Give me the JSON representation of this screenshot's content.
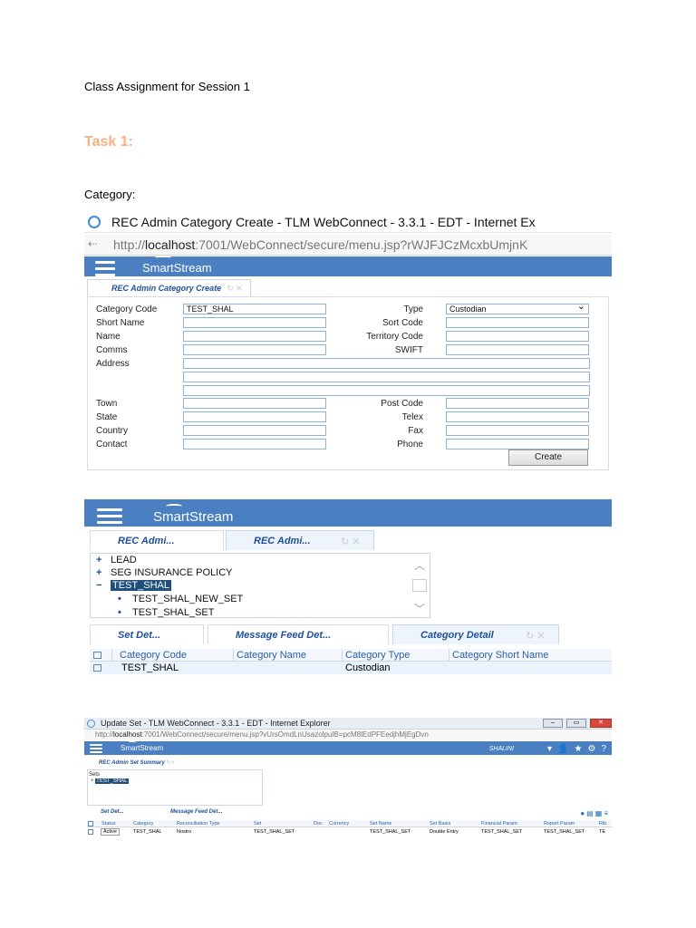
{
  "document": {
    "title": "Class Assignment for Session 1",
    "task_heading": "Task 1:",
    "section_label": "Category:"
  },
  "shot1": {
    "window_title": "REC Admin Category Create - TLM WebConnect - 3.3.1 - EDT - Internet Ex",
    "url_prefix": "http://",
    "url_host": "localhost",
    "url_rest": ":7001/WebConnect/secure/menu.jsp?rWJFJCzMcxbUmjnK",
    "logo": "SmartStream",
    "tab_label": "REC Admin Category Create",
    "tab_icons": "↻ ✕",
    "fields": {
      "category_code_label": "Category Code",
      "category_code_value": "TEST_SHAL",
      "short_name_label": "Short Name",
      "name_label": "Name",
      "comms_label": "Comms",
      "address_label": "Address",
      "town_label": "Town",
      "state_label": "State",
      "country_label": "Country",
      "contact_label": "Contact",
      "type_label": "Type",
      "type_value": "Custodian",
      "sort_code_label": "Sort Code",
      "territory_code_label": "Territory Code",
      "swift_label": "SWIFT",
      "post_code_label": "Post Code",
      "telex_label": "Telex",
      "fax_label": "Fax",
      "phone_label": "Phone"
    },
    "create_button": "Create"
  },
  "shot2": {
    "logo": "SmartStream",
    "top_tabs": [
      "REC Admi...",
      "REC Admi..."
    ],
    "tree": [
      {
        "symbol": "+",
        "label": "LEAD"
      },
      {
        "symbol": "+",
        "label": "SEG INSURANCE POLICY"
      },
      {
        "symbol": "−",
        "label": "TEST_SHAL"
      },
      {
        "symbol": "•",
        "label": "TEST_SHAL_NEW_SET"
      },
      {
        "symbol": "•",
        "label": "TEST_SHAL_SET"
      }
    ],
    "bottom_tabs": [
      "Set Det...",
      "Message Feed Det...",
      "Category Detail"
    ],
    "grid_headers": [
      "Category Code",
      "Category Name",
      "Category Type",
      "Category Short Name"
    ],
    "grid_row": [
      "TEST_SHAL",
      "",
      "Custodian",
      ""
    ]
  },
  "shot3": {
    "window_title": "Update Set - TLM WebConnect - 3.3.1 - EDT - Internet Explorer",
    "url_prefix": "http://",
    "url_host": "localhost",
    "url_rest": ":7001/WebConnect/secure/menu.jsp?vUrsOmdLnUsazolpuIB=pcM8lEdPFEedjhMjEgDvn",
    "logo": "SmartStream",
    "user": "SHALINI",
    "tab_label": "REC Admin Set Summary",
    "tree_label": "Sets",
    "tree_node": "TEST_SHAL",
    "bottom_tabs": [
      "Set Det...",
      "Message Feed Det..."
    ],
    "grid_headers": [
      "Status",
      "Category",
      "Reconciliation Type",
      "Set",
      "Doc",
      "Currency",
      "Set Name",
      "Set Basis",
      "Financial Param",
      "Report Param",
      "Rib"
    ],
    "grid_row": [
      "Active",
      "TEST_SHAL",
      "Nostro",
      "TEST_SHAL_SET",
      "",
      "",
      "TEST_SHAL_SET",
      "Double Entry",
      "TEST_SHAL_SET",
      "TEST_SHAL_SET",
      "TE"
    ]
  }
}
